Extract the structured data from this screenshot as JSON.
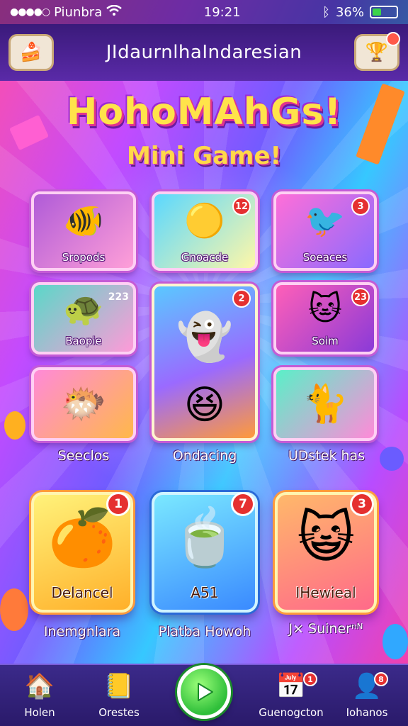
{
  "status_bar": {
    "carrier": "Piunbra",
    "time": "19:21",
    "battery": "36%",
    "battery_level": 0.36
  },
  "header": {
    "title": "JIdaurnlhaIndaresian",
    "left_icon": "cake-icon",
    "right_icon": "trophy-icon"
  },
  "logo": {
    "title": "HohoMAhGs!",
    "subtitle": "Mini Game!"
  },
  "cards": [
    {
      "label": "Sropods",
      "badge": "",
      "icon": "fish-icon"
    },
    {
      "label": "Gnoacde",
      "badge": "12",
      "icon": "ball-icon"
    },
    {
      "label": "Soeaces",
      "badge": "3",
      "icon": "bird-icon"
    },
    {
      "label": "Baopie",
      "badge": "223",
      "icon": "turtle-icon"
    },
    {
      "label": "Soim",
      "badge": "23",
      "icon": "cat-icon"
    },
    {
      "label": "",
      "badge": "",
      "icon": "fish-icon"
    },
    {
      "label": "",
      "badge": "",
      "icon": "cat-icon"
    }
  ],
  "center_card": {
    "badge": "2",
    "icon": "ghost-icon"
  },
  "row_labels": [
    "Seeclos",
    "Ondacing",
    "UDstek has"
  ],
  "big_cards": [
    {
      "label": "Delancel",
      "badge": "1",
      "caption": "Inemgnlara",
      "icon": "fruit-icon"
    },
    {
      "label": "A51",
      "badge": "7",
      "caption": "Platba Howoh",
      "icon": "cup-icon"
    },
    {
      "label": "IHewieal",
      "badge": "3",
      "caption": "J⨯ Suinerⁿᴺ",
      "icon": "cat-icon"
    }
  ],
  "tabs": [
    {
      "label": "Holen",
      "icon": "house-icon",
      "badge": ""
    },
    {
      "label": "Orestes",
      "icon": "book-icon",
      "badge": ""
    },
    {
      "label": "Guenogcton",
      "icon": "calendar-icon",
      "badge": "1"
    },
    {
      "label": "Iohanos",
      "icon": "profile-icon",
      "badge": "8"
    }
  ],
  "colors": {
    "badge": "#e53030",
    "play": "#2fbf3a",
    "tab_bar": "#2a1a6a",
    "logo_fill": "#ffe34a"
  }
}
